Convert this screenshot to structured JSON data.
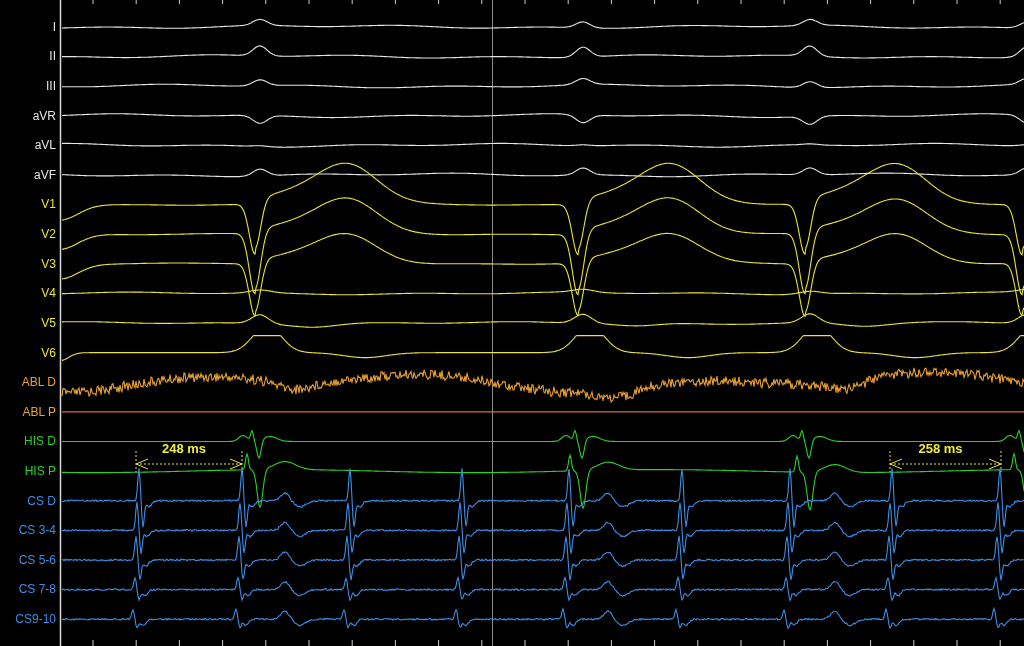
{
  "channels": [
    {
      "label": "I",
      "color": "#e6e6e6"
    },
    {
      "label": "II",
      "color": "#e6e6e6"
    },
    {
      "label": "III",
      "color": "#e6e6e6"
    },
    {
      "label": "aVR",
      "color": "#e6e6e6"
    },
    {
      "label": "aVL",
      "color": "#e6e6e6"
    },
    {
      "label": "aVF",
      "color": "#e6e6e6"
    },
    {
      "label": "V1",
      "color": "#e8e43a"
    },
    {
      "label": "V2",
      "color": "#e8e43a"
    },
    {
      "label": "V3",
      "color": "#e8e43a"
    },
    {
      "label": "V4",
      "color": "#e8e43a"
    },
    {
      "label": "V5",
      "color": "#e8e43a"
    },
    {
      "label": "V6",
      "color": "#e8e43a"
    },
    {
      "label": "ABL D",
      "color": "#e8a030"
    },
    {
      "label": "ABL P",
      "color": "#e8a030"
    },
    {
      "label": "HIS D",
      "color": "#2cd02c"
    },
    {
      "label": "HIS P",
      "color": "#2cd02c"
    },
    {
      "label": "CS D",
      "color": "#3a8ee8"
    },
    {
      "label": "CS 3-4",
      "color": "#3a8ee8"
    },
    {
      "label": "CS 5-6",
      "color": "#3a8ee8"
    },
    {
      "label": "CS 7-8",
      "color": "#3a8ee8"
    },
    {
      "label": "CS9-10",
      "color": "#3a8ee8"
    }
  ],
  "measurements": [
    {
      "label": "248 ms"
    },
    {
      "label": "258 ms"
    }
  ]
}
